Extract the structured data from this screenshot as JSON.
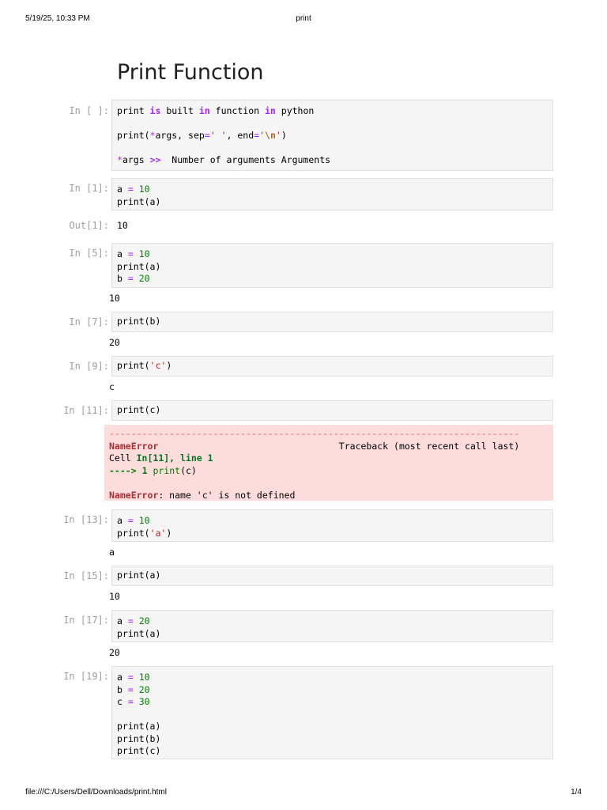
{
  "header": {
    "datetime": "5/19/25, 10:33 PM",
    "doc_title": "print"
  },
  "footer": {
    "path": "file:///C:/Users/Dell/Downloads/print.html",
    "page": "1/4"
  },
  "notebook": {
    "title": "Print Function"
  },
  "cells": {
    "c0": {
      "prompt": "In [ ]:",
      "line1": {
        "a": "print ",
        "b": "is",
        "c": " built ",
        "d": "in",
        "e": " function ",
        "f": "in",
        "g": " python"
      },
      "line2": {
        "a": "print(",
        "b": "*",
        "c": "args, sep",
        "d": "=",
        "e": "' '",
        "f": ", end",
        "g": "=",
        "h": "'",
        "i": "\\n",
        "j": "'",
        "k": ")"
      },
      "line3": {
        "a": "*",
        "b": "args ",
        "c": ">>",
        "d": "  Number of arguments Arguments"
      }
    },
    "c1": {
      "prompt": "In [1]:",
      "var": "a",
      "eq": "=",
      "val": "10",
      "call": "print(a)",
      "out_prompt": "Out[1]:",
      "out": "10"
    },
    "c5": {
      "prompt": "In [5]:",
      "l1": {
        "v": "a",
        "eq": "=",
        "n": "10"
      },
      "l2": "print(a)",
      "l3": {
        "v": "b",
        "eq": "=",
        "n": "20"
      },
      "out": "10"
    },
    "c7": {
      "prompt": "In [7]:",
      "code": "print(b)",
      "out": "20"
    },
    "c9": {
      "prompt": "In [9]:",
      "pre": "print(",
      "str": "'c'",
      "post": ")",
      "out": "c"
    },
    "c11": {
      "prompt": "In [11]:",
      "code": "print(c)",
      "error": {
        "rule": "---------------------------------------------------------------------------",
        "name": "NameError",
        "traceback": "Traceback (most recent call last)",
        "cell_prefix": "Cell ",
        "cell_ref": "In[11], line 1",
        "arrow": "---->",
        "line_no": "1",
        "line_code_pre": "print",
        "line_code_post": "(c)",
        "msg_name": "NameError",
        "msg": ": name 'c' is not defined"
      }
    },
    "c13": {
      "prompt": "In [13]:",
      "l1": {
        "v": "a",
        "eq": "=",
        "n": "10"
      },
      "pre": "print(",
      "str": "'a'",
      "post": ")",
      "out": "a"
    },
    "c15": {
      "prompt": "In [15]:",
      "code": "print(a)",
      "out": "10"
    },
    "c17": {
      "prompt": "In [17]:",
      "l1": {
        "v": "a",
        "eq": "=",
        "n": "20"
      },
      "l2": "print(a)",
      "out": "20"
    },
    "c19": {
      "prompt": "In [19]:",
      "l1": {
        "v": "a",
        "eq": "=",
        "n": "10"
      },
      "l2": {
        "v": "b",
        "eq": "=",
        "n": "20"
      },
      "l3": {
        "v": "c",
        "eq": "=",
        "n": "30"
      },
      "l5": "print(a)",
      "l6": "print(b)",
      "l7": "print(c)"
    }
  }
}
